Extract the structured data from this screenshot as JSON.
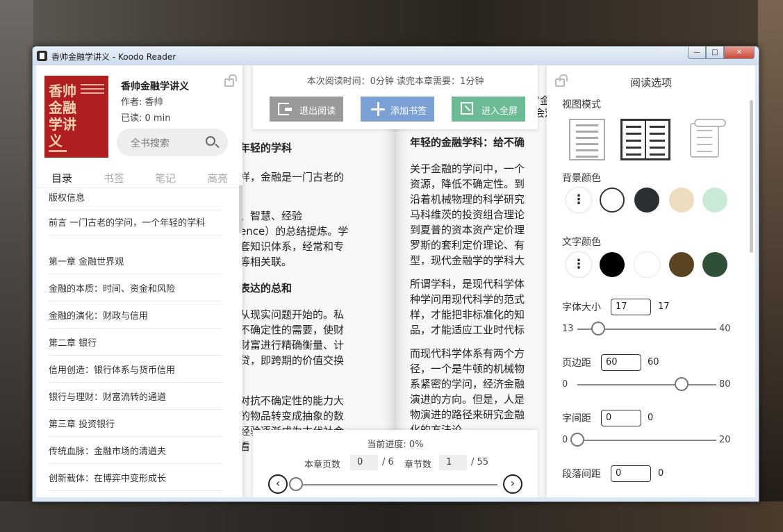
{
  "window": {
    "title": "香帅金融学讲义 - Koodo Reader",
    "minimize": "—",
    "maximize": "□",
    "close": "✕"
  },
  "sidebar": {
    "cover": {
      "title": "香帅金融学讲义"
    },
    "book_title": "香帅金融学讲义",
    "author": "作者: 香帅",
    "read_time": "已读: 0  min",
    "search_placeholder": "全书搜索",
    "tabs": [
      "目录",
      "书签",
      "笔记",
      "高亮"
    ],
    "toc": [
      "版权信息",
      "前言 一门古老的学问，一个年轻的学科",
      "第一章 金融世界观",
      "金融的本质：时间、资金和风险",
      "金融的演化：财政与信用",
      "第二章 银行",
      "信用创造：银行体系与货币信用",
      "银行与理财：财富流转的通道",
      "第三章 投资银行",
      "传统血脉：金融市场的清道夫",
      "创新载体：在博弈中变形成长"
    ]
  },
  "toolbar": {
    "reading_time": "本次阅读时间：0分钟   读完本章需要：1分钟",
    "exit_label": "退出阅读",
    "bookmark_label": "添加书签",
    "fullscreen_label": "进入全屏"
  },
  "pages": {
    "left_lines": [
      "年轻的学科",
      "样，金融是一门古老的",
      "",
      "、智慧、经验",
      "ence）的总结提炼。学",
      "套知识体系，经常和专",
      "等相关联。",
      "表达的总和",
      "从现实问题开始的。私",
      "不确定性的需要，使财",
      "财富进行精确衡量、计",
      "贷，即跨期的价值交换",
      "对抗不确定性的能力大",
      "的物品转变成抽象的数",
      "经验逐渐成为古代社会",
      "看"
    ],
    "right_lines": [
      "年轻的金融学科：给不确",
      "关于金融的学问中，一个",
      "资源，降低不确定性。到",
      "沿着机械物理的科学研究",
      "马科维茨的投资组合理论",
      "到夏普的资本资产定价理",
      "罗斯的套利定价理论、有",
      "型，现代金融学的学科大",
      "所谓学科，是现代科学体",
      "种学问用现代科学的范式",
      "样，才能把非标准化的知",
      "品，才能适应工业时代标",
      "而现代科学体系有两个方",
      "径，一个是牛顿的机械物",
      "系紧密的学问，经济金融",
      "演进的方向。但是，人是",
      "物演进的路径来研究金融",
      "化的方法论"
    ],
    "right_top_fragments": [
      "“金",
      "会观"
    ]
  },
  "progress": {
    "current": "当前进度: 0%",
    "chapter_pages_label": "本章页数",
    "chapter_page_value": "0",
    "chapter_page_total": "/ 6",
    "chapter_num_label": "章节数",
    "chapter_num_value": "1",
    "chapter_num_total": "/ 55",
    "prev_icon": "‹",
    "next_icon": "›",
    "percent": 0
  },
  "settings": {
    "title": "阅读选项",
    "view_mode_label": "视图模式",
    "bg_color_label": "背景颜色",
    "bg_colors": [
      "#ffffff",
      "#2b2e33",
      "#eedcc0",
      "#c9ead4"
    ],
    "text_color_label": "文字颜色",
    "text_colors": [
      "#000000",
      "#ffffff",
      "#5a4321",
      "#2f5036"
    ],
    "font_size": {
      "label": "字体大小",
      "value": "17",
      "display": "17",
      "min": "13",
      "max": "40",
      "fraction": 0.15
    },
    "margin": {
      "label": "页边距",
      "value": "60",
      "display": "60",
      "min": "0",
      "max": "80",
      "fraction": 0.75
    },
    "letter_spacing": {
      "label": "字间距",
      "value": "0",
      "display": "0",
      "min": "0",
      "max": "20",
      "fraction": 0.0
    },
    "paragraph_spacing": {
      "label": "段落间距",
      "value": "0",
      "display": "0"
    }
  }
}
